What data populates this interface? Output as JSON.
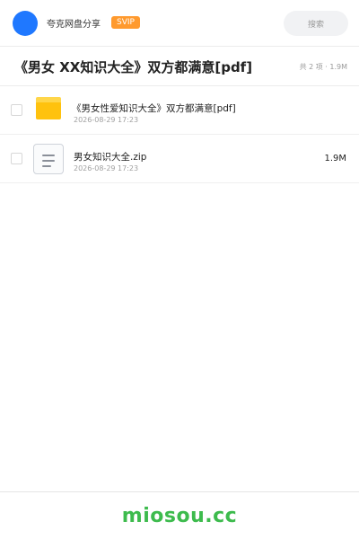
{
  "header": {
    "app_name": "夸克网盘分享",
    "badge": "SVIP",
    "search_placeholder": "搜索",
    "avatar_color": "#1f78ff",
    "badge_color": "#ff9a2e"
  },
  "title_bar": {
    "title": "《男女 XX知识大全》双方都满意[pdf]",
    "summary": "共 2 项 · 1.9M"
  },
  "files": [
    {
      "name": "《男女性爱知识大全》双方都满意[pdf]",
      "date": "2026-08-29 17:23",
      "size": "",
      "icon": "folder-icon"
    },
    {
      "name": "男女知识大全.zip",
      "date": "2026-08-29 17:23",
      "size": "1.9M",
      "icon": "zip-file-icon"
    }
  ],
  "footer": {
    "watermark": "miosou.cc",
    "watermark_color": "#3dbb4d"
  }
}
